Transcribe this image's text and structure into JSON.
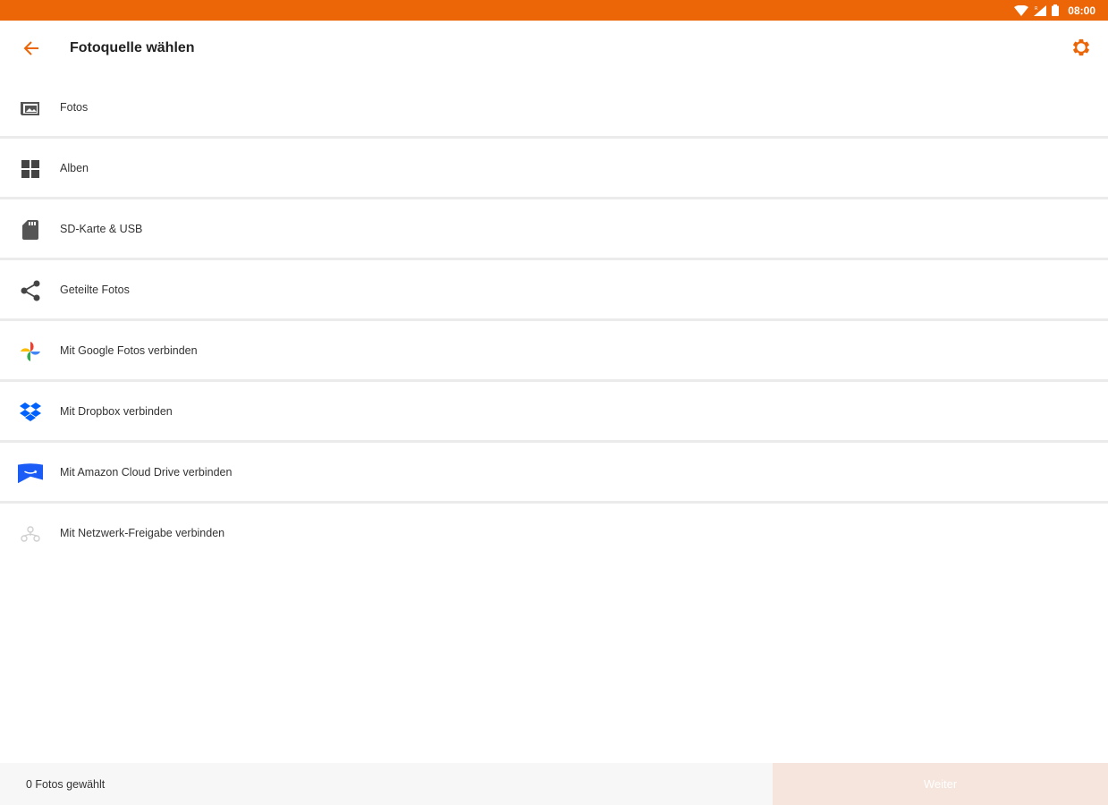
{
  "status_bar": {
    "time": "08:00",
    "bg_color": "#ec6608",
    "icons": [
      "wifi-icon",
      "signal-icon",
      "battery-icon"
    ]
  },
  "app_bar": {
    "title": "Fotoquelle wählen",
    "back_icon": "arrow-left-icon",
    "settings_icon": "gear-icon",
    "accent_color": "#ec6608"
  },
  "sources": [
    {
      "label": "Fotos",
      "icon": "photo-folder-icon"
    },
    {
      "label": "Alben",
      "icon": "grid-icon"
    },
    {
      "label": "SD-Karte & USB",
      "icon": "sd-card-icon"
    },
    {
      "label": "Geteilte Fotos",
      "icon": "share-icon"
    },
    {
      "label": "Mit Google Fotos verbinden",
      "icon": "google-photos-icon"
    },
    {
      "label": "Mit Dropbox verbinden",
      "icon": "dropbox-icon"
    },
    {
      "label": "Mit Amazon Cloud Drive verbinden",
      "icon": "amazon-drive-icon"
    },
    {
      "label": "Mit Netzwerk-Freigabe verbinden",
      "icon": "network-share-icon"
    }
  ],
  "footer": {
    "selected_count": "0 Fotos gewählt",
    "next_label": "Weiter"
  }
}
